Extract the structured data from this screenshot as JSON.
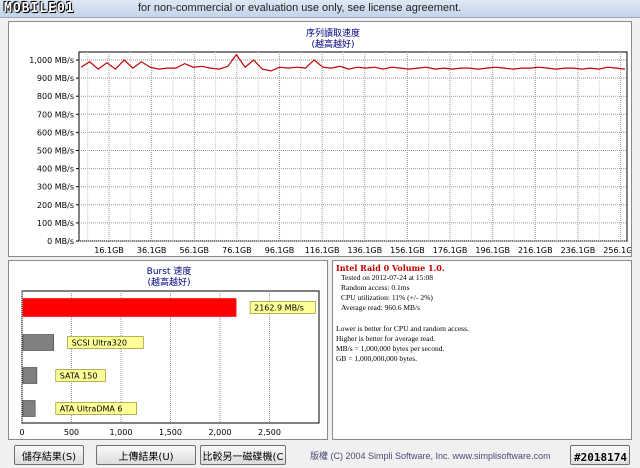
{
  "window": {
    "logo": "MOBILE01",
    "title": "for non-commercial or evaluation use only, see license agreement."
  },
  "seq_chart": {
    "title_line1": "序列讀取速度",
    "title_line2": "(越高越好)",
    "chart_data": {
      "type": "line",
      "title": "序列讀取速度 (越高越好)",
      "ylim": [
        0,
        1000
      ],
      "y_ticks": [
        "1,000 MB/s",
        "900 MB/s",
        "800 MB/s",
        "700 MB/s",
        "600 MB/s",
        "500 MB/s",
        "400 MB/s",
        "300 MB/s",
        "200 MB/s",
        "100 MB/s",
        "0 MB/s"
      ],
      "x_ticks": [
        "16.1GB",
        "36.1GB",
        "56.1GB",
        "76.1GB",
        "96.1GB",
        "116.1GB",
        "136.1GB",
        "156.1GB",
        "176.1GB",
        "196.1GB",
        "216.1GB",
        "236.1GB",
        "256.1GB"
      ],
      "grid": true,
      "series": [
        {
          "color": "#c00000",
          "values": [
            960,
            990,
            950,
            985,
            950,
            1000,
            955,
            990,
            960,
            950,
            955,
            955,
            980,
            960,
            965,
            955,
            950,
            965,
            1030,
            960,
            1000,
            950,
            940,
            960,
            955,
            960,
            955,
            1000,
            960,
            955,
            965,
            950,
            960,
            955,
            960,
            950,
            960,
            955,
            950,
            955,
            960,
            950,
            955,
            950,
            955,
            955,
            950,
            955,
            960,
            955,
            950,
            955,
            955,
            960,
            955,
            950,
            955,
            955,
            950,
            955,
            950,
            960,
            955,
            950
          ]
        }
      ]
    }
  },
  "burst_chart": {
    "title_line1": "Burst 速度",
    "title_line2": "(越高越好)",
    "chart_data": {
      "type": "bar",
      "title": "Burst 速度 (越高越好)",
      "xlim": [
        0,
        3000
      ],
      "x_ticks": [
        "0",
        "500",
        "1,000",
        "1,500",
        "2,000",
        "2,500"
      ],
      "bars": [
        {
          "label": "2162.9 MB/s",
          "value": 2162.9,
          "color": "#ff0000"
        },
        {
          "label": "SCSI Ultra320",
          "value": 320,
          "color": "#808080"
        },
        {
          "label": "SATA 150",
          "value": 150,
          "color": "#808080"
        },
        {
          "label": "ATA UltraDMA 6",
          "value": 133,
          "color": "#808080"
        }
      ]
    }
  },
  "info": {
    "title": "Intel Raid 0 Volume 1.0.",
    "lines": [
      "Tested on 2012-07-24 at 15:08",
      "Random access: 0.1ms",
      "CPU utilization: 11% (+/- 2%)",
      "Average read: 960.6 MB/s"
    ],
    "notes": [
      "Lower is better for CPU and random access.",
      "Higher is better for average read.",
      "MB/s = 1,000,000 bytes per second.",
      "GB = 1,000,000,000 bytes."
    ]
  },
  "buttons": {
    "save": "儲存結果(S)",
    "upload": "上傳結果(U)",
    "compare": "比較另一磁碟機(C",
    "right": "..."
  },
  "copyright": "版權 (C) 2004 Simpli Software, Inc. www.simplisoftware.com",
  "watermark": "#2018174"
}
